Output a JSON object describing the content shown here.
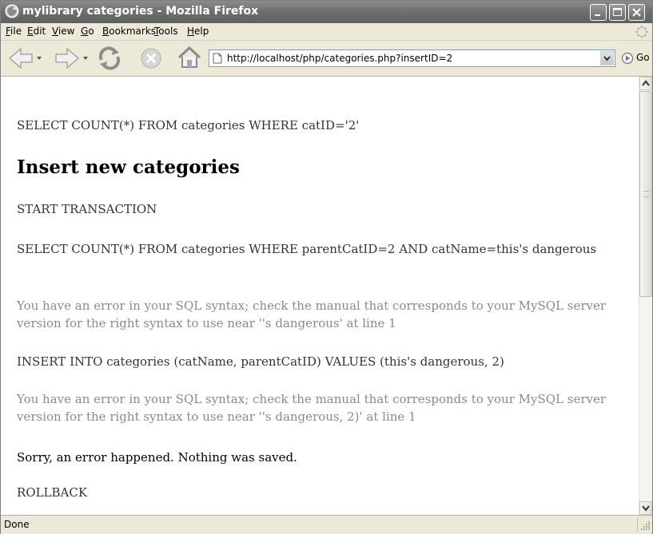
{
  "window": {
    "title": "mylibrary categories - Mozilla Firefox",
    "controls": [
      "minimize-icon",
      "maximize-icon",
      "close-icon"
    ]
  },
  "menu": {
    "items": [
      "File",
      "Edit",
      "View",
      "Go",
      "Bookmarks",
      "Tools",
      "Help"
    ]
  },
  "toolbar": {
    "buttons": [
      "back-arrow-icon",
      "back-dropdown-icon",
      "forward-arrow-icon",
      "forward-dropdown-icon",
      "reload-icon",
      "stop-icon",
      "home-icon"
    ],
    "url": "http://localhost/php/categories.php?insertID=2",
    "go_label": "Go"
  },
  "content": {
    "query1": "SELECT COUNT(*) FROM categories WHERE catID='2'",
    "heading": "Insert new categories",
    "start": "START TRANSACTION",
    "query2": "SELECT COUNT(*) FROM categories WHERE parentCatID=2 AND catName=this's dangerous",
    "error1": "You have an error in your SQL syntax; check the manual that corresponds to your MySQL server version for the right syntax to use near ''s dangerous' at line 1",
    "insert": "INSERT INTO categories (catName, parentCatID) VALUES (this's dangerous, 2)",
    "error2": "You have an error in your SQL syntax; check the manual that corresponds to your MySQL server version for the right syntax to use near ''s dangerous, 2)' at line 1",
    "sorry": "Sorry, an error happened. Nothing was saved.",
    "rollback": "ROLLBACK"
  },
  "status": {
    "text": "Done"
  },
  "colors": {
    "titlebar": "#707070",
    "chrome": "#ece9d8",
    "text_gray": "#8a8a8a",
    "text_dark": "#333333"
  }
}
